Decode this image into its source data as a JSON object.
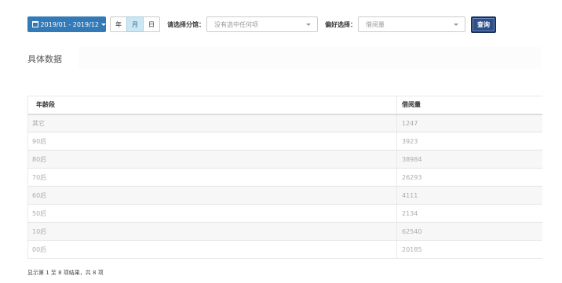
{
  "toolbar": {
    "date_range": "2019/01 - 2019/12",
    "granularity": [
      "年",
      "月",
      "日"
    ],
    "active_granularity": "月",
    "branch_label": "请选择分馆：",
    "branch_placeholder": "没有选中任何项",
    "preference_label": "偏好选择：",
    "preference_value": "借阅量",
    "query_label": "查询"
  },
  "section": {
    "title": "具体数据"
  },
  "table": {
    "columns": [
      "年龄段",
      "借阅量"
    ],
    "rows": [
      [
        "其它",
        "1247"
      ],
      [
        "90后",
        "3923"
      ],
      [
        "80后",
        "38984"
      ],
      [
        "70后",
        "26293"
      ],
      [
        "60后",
        "4111"
      ],
      [
        "50后",
        "2134"
      ],
      [
        "10后",
        "62540"
      ],
      [
        "00后",
        "20185"
      ]
    ]
  },
  "footer": {
    "info": "显示第 1 至 8 项结果，共 8 项"
  },
  "colors": {
    "primary": "#337ab7",
    "query_button": "#2e4f8a",
    "active_segment": "#cbe7f3"
  }
}
